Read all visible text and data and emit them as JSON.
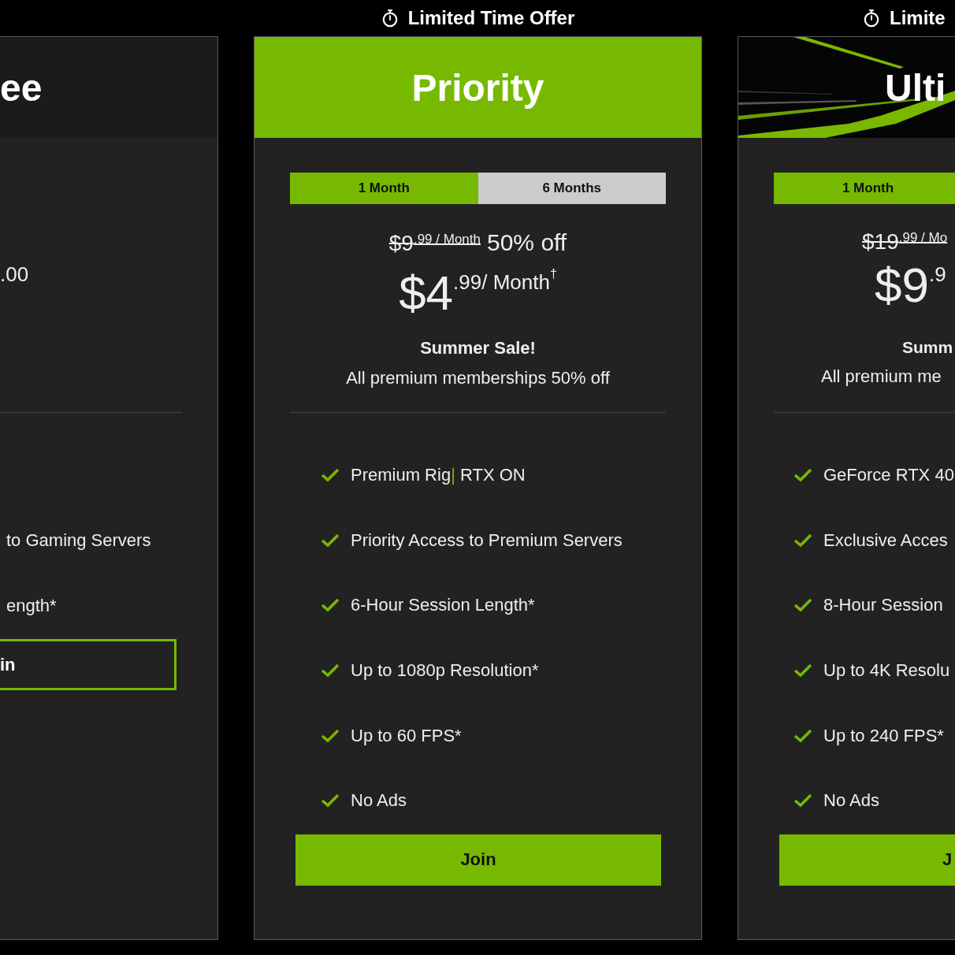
{
  "plans": [
    {
      "kind": "left",
      "title": "ee",
      "price": {
        "cents": ".00"
      },
      "features": [
        {
          "text": "to Gaming Servers"
        },
        {
          "text": "ength*"
        }
      ],
      "join": {
        "label": "in"
      }
    },
    {
      "kind": "center",
      "offer": "Limited Time Offer",
      "title": "Priority",
      "tabs": [
        {
          "label": "1 Month",
          "selected": true
        },
        {
          "label": "6 Months",
          "selected": false
        }
      ],
      "original_price": {
        "dollars": "$9",
        "rest": ".99 / Month"
      },
      "discount": "50% off",
      "price": {
        "dollars": "$4",
        "cents": ".99",
        "unit": "/ Month",
        "mark": "†"
      },
      "sale_title": "Summer Sale!",
      "sale_text": "All premium memberships 50% off",
      "features": [
        {
          "text": "Premium Rig",
          "divider": "|",
          "text2": "RTX ON"
        },
        {
          "text": "Priority Access to Premium Servers"
        },
        {
          "text": "6-Hour Session Length*"
        },
        {
          "text": "Up to 1080p Resolution*"
        },
        {
          "text": "Up to 60 FPS*"
        },
        {
          "text": "No Ads"
        }
      ],
      "join": {
        "label": "Join"
      }
    },
    {
      "kind": "right",
      "offer": "Limite",
      "title": "Ulti",
      "tabs": [
        {
          "label": "1 Month",
          "selected": true
        }
      ],
      "original_price": {
        "dollars": "$19",
        "rest": ".99 / Mo"
      },
      "price": {
        "dollars": "$9",
        "cents": ".9"
      },
      "sale_title": "Summ",
      "sale_text": "All premium me",
      "features": [
        {
          "text": "GeForce RTX 40"
        },
        {
          "text": "Exclusive Acces"
        },
        {
          "text": "8-Hour Session"
        },
        {
          "text": "Up to 4K Resolu"
        },
        {
          "text": "Up to 240 FPS*"
        },
        {
          "text": "No Ads"
        }
      ],
      "join": {
        "label": "J"
      }
    }
  ]
}
